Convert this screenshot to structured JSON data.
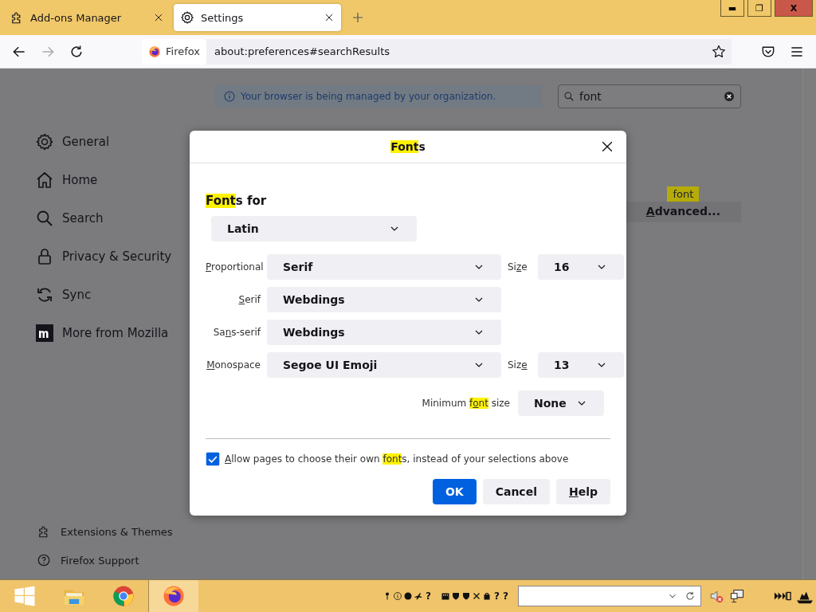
{
  "tabs": [
    {
      "label": "Add-ons Manager",
      "kind": "puzzle",
      "selected": false
    },
    {
      "label": "Settings",
      "kind": "gear",
      "selected": true
    }
  ],
  "window_controls": {
    "minimize": "▬",
    "restore": "❐",
    "close": "X"
  },
  "address_bar": {
    "identity": "Firefox",
    "url": "about:preferences#searchResults"
  },
  "managed_notice": "Your browser is being managed by your organization.",
  "search": {
    "value": "font"
  },
  "sidebar": {
    "items": [
      {
        "label": "General",
        "kind": "gear"
      },
      {
        "label": "Home",
        "kind": "home"
      },
      {
        "label": "Search",
        "kind": "search"
      },
      {
        "label": "Privacy & Security",
        "kind": "lock"
      },
      {
        "label": "Sync",
        "kind": "sync"
      },
      {
        "label": "More from Mozilla",
        "kind": "mozilla"
      }
    ],
    "footer": [
      {
        "label": "Extensions & Themes",
        "kind": "puzzle"
      },
      {
        "label": "Firefox Support",
        "kind": "help"
      }
    ]
  },
  "search_tooltip": "font",
  "advanced_button": [
    {
      "text": "A",
      "underline": true
    },
    {
      "text": "dvanced..."
    }
  ],
  "dialog": {
    "title": [
      {
        "text": "Font",
        "highlight": true
      },
      {
        "text": "s"
      }
    ],
    "fonts_for_label": [
      {
        "text": "Font",
        "highlight": true
      },
      {
        "text": "s for"
      }
    ],
    "language": "Latin",
    "rows": [
      {
        "label": [
          {
            "text": "P",
            "underline": true
          },
          {
            "text": "roportional"
          }
        ],
        "value": "Serif",
        "size_label": [
          {
            "text": "Si"
          },
          {
            "text": "z",
            "underline": true
          },
          {
            "text": "e"
          }
        ],
        "size": "16"
      },
      {
        "label": [
          {
            "text": "S",
            "underline": true
          },
          {
            "text": "erif"
          }
        ],
        "value": "Webdings"
      },
      {
        "label": [
          {
            "text": "Sa"
          },
          {
            "text": "n",
            "underline": true
          },
          {
            "text": "s-serif"
          }
        ],
        "value": "Webdings"
      },
      {
        "label": [
          {
            "text": "M",
            "underline": true
          },
          {
            "text": "onospace"
          }
        ],
        "value": "Segoe UI Emoji",
        "size_label": [
          {
            "text": "Siz"
          },
          {
            "text": "e",
            "underline": true
          }
        ],
        "size": "13"
      }
    ],
    "minimum_label": [
      {
        "text": "Minimum "
      },
      {
        "text": "f",
        "highlight": true
      },
      {
        "text": "o",
        "highlight": true,
        "underline": true
      },
      {
        "text": "nt",
        "highlight": true
      },
      {
        "text": " size"
      }
    ],
    "minimum_value": "None",
    "allow": {
      "checked": true,
      "label": [
        {
          "text": "A",
          "underline": true
        },
        {
          "text": "llow pages to choose their own "
        },
        {
          "text": "font",
          "highlight": true
        },
        {
          "text": "s, instead of your selections above"
        }
      ]
    },
    "buttons": [
      {
        "label": [
          {
            "text": "OK"
          }
        ],
        "primary": true
      },
      {
        "label": [
          {
            "text": "Cancel"
          }
        ],
        "primary": false
      },
      {
        "label": [
          {
            "text": "H",
            "underline": true
          },
          {
            "text": "elp"
          }
        ],
        "primary": false
      }
    ]
  },
  "taskbar": {
    "apps": [
      {
        "kind": "windows",
        "selected": false
      },
      {
        "kind": "folder",
        "selected": false
      },
      {
        "kind": "chrome",
        "selected": false
      },
      {
        "kind": "firefox",
        "selected": true
      }
    ],
    "glyphs_1": "?",
    "glyphs_2": "? ?"
  }
}
